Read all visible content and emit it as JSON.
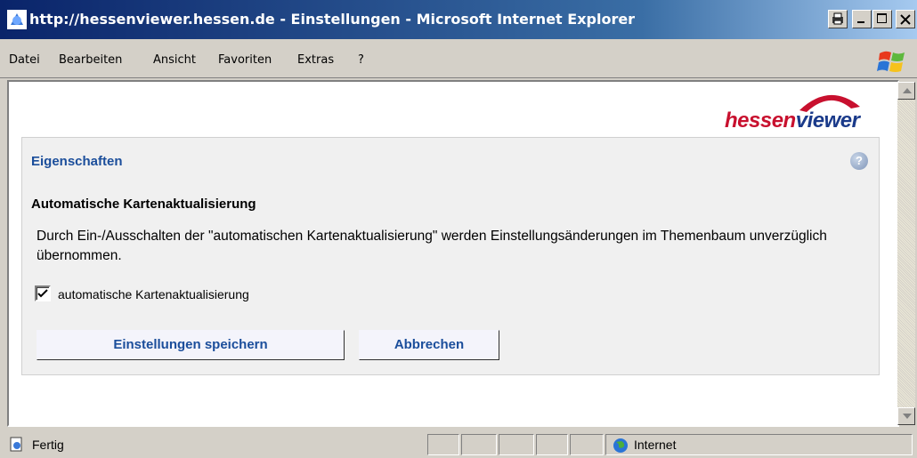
{
  "window": {
    "title": "http://hessenviewer.hessen.de - Einstellungen - Microsoft Internet Explorer",
    "controls": [
      "print-icon",
      "minimize-icon",
      "maximize-icon",
      "close-icon"
    ]
  },
  "menu": {
    "items": [
      "Datei",
      "Bearbeiten",
      "Ansicht",
      "Favoriten",
      "Extras",
      "?"
    ]
  },
  "logo": {
    "part_a": "hessen",
    "part_b": "viewer",
    "colors": {
      "red": "#c8102e",
      "blue": "#1a3a8a"
    }
  },
  "panel": {
    "title": "Eigenschaften",
    "help_icon": "help-icon",
    "heading": "Automatische Kartenaktualisierung",
    "description": "Durch Ein-/Ausschalten der \"automatischen Kartenaktualisierung\" werden Einstellungsänderungen im Themenbaum unverzüglich übernommen.",
    "checkbox": {
      "label": "automatische Kartenaktualisierung",
      "checked": true
    },
    "buttons": {
      "save": "Einstellungen speichern",
      "cancel": "Abbrechen"
    }
  },
  "status": {
    "text": "Fertig",
    "zone": "Internet"
  },
  "colors": {
    "title_blue": "#1b4e9b",
    "panel_bg": "#f0f0f0"
  }
}
